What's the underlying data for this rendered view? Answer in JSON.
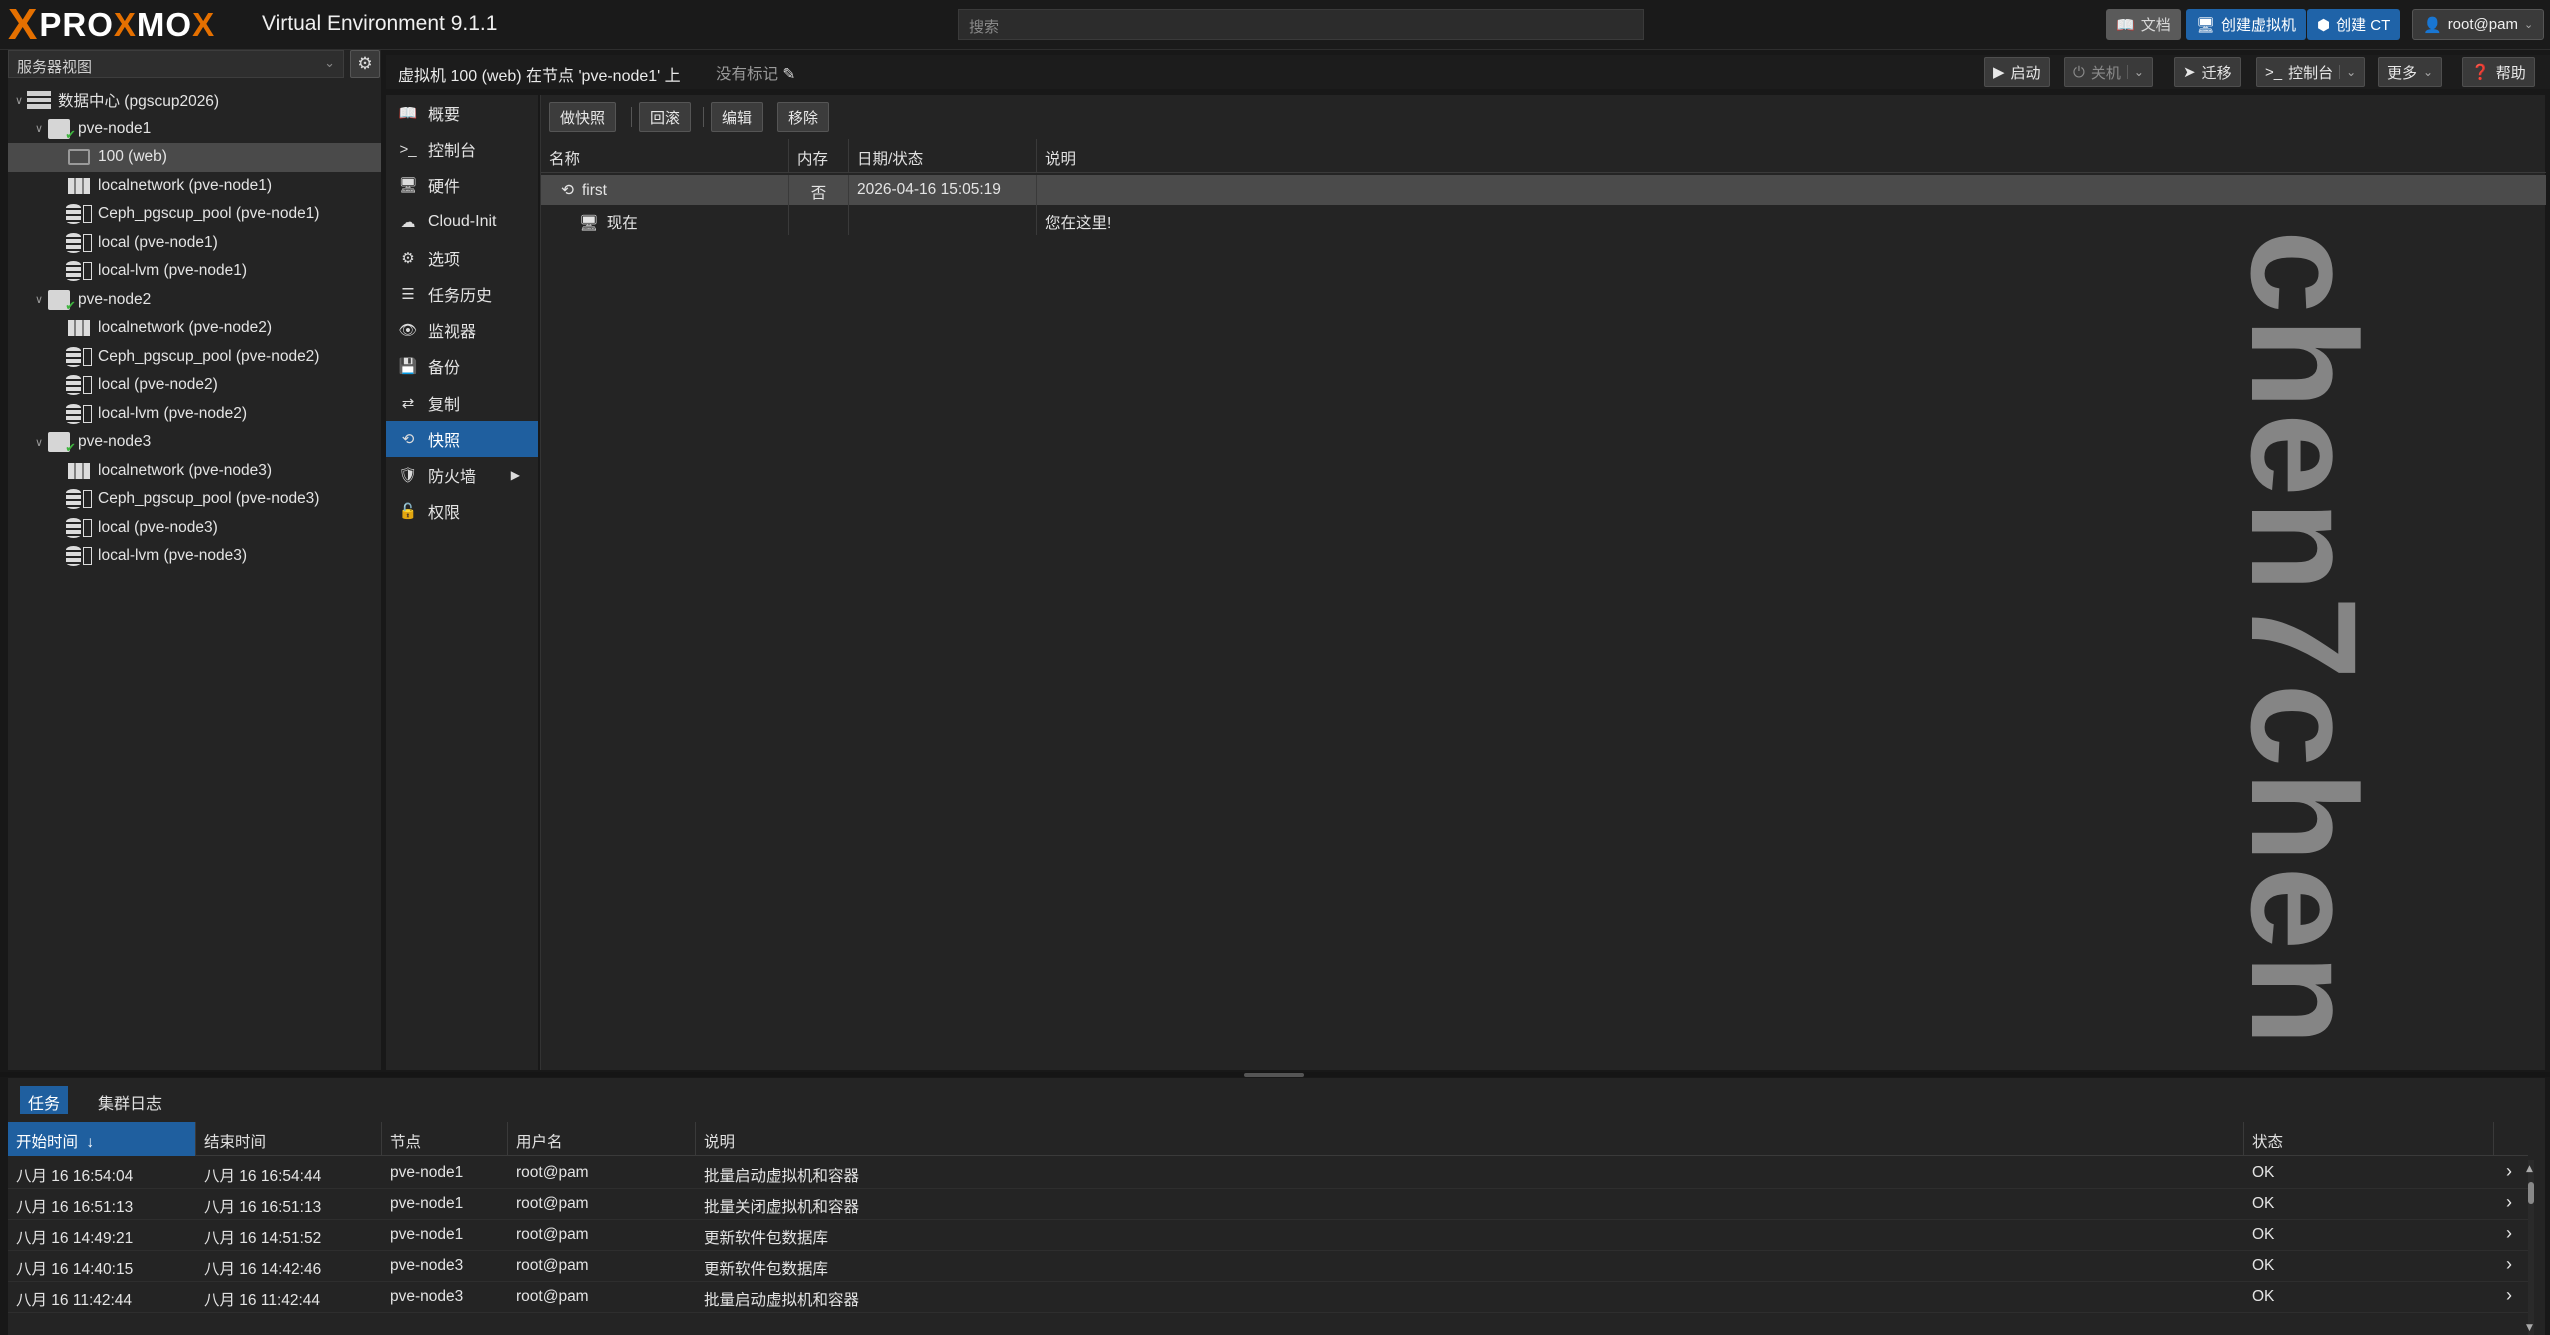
{
  "app": {
    "logo_x": "X",
    "logo_text_a": "PRO",
    "logo_text_b": "X",
    "logo_text_c": "MO",
    "logo_text_d": "X",
    "title": "Virtual Environment 9.1.1",
    "search_placeholder": "搜索"
  },
  "topbar": {
    "docs": "文档",
    "create_vm": "创建虚拟机",
    "create_ct": "创建 CT",
    "user": "root@pam"
  },
  "resource_tree": {
    "view": "服务器视图",
    "items": [
      {
        "label": "数据中心 (pgscup2026)",
        "type": "datacenter"
      },
      {
        "label": "pve-node1",
        "type": "node"
      },
      {
        "label": "100 (web)",
        "type": "vm"
      },
      {
        "label": "localnetwork (pve-node1)",
        "type": "network"
      },
      {
        "label": "Ceph_pgscup_pool (pve-node1)",
        "type": "storage"
      },
      {
        "label": "local (pve-node1)",
        "type": "storage"
      },
      {
        "label": "local-lvm (pve-node1)",
        "type": "storage"
      },
      {
        "label": "pve-node2",
        "type": "node"
      },
      {
        "label": "localnetwork (pve-node2)",
        "type": "network"
      },
      {
        "label": "Ceph_pgscup_pool (pve-node2)",
        "type": "storage"
      },
      {
        "label": "local (pve-node2)",
        "type": "storage"
      },
      {
        "label": "local-lvm (pve-node2)",
        "type": "storage"
      },
      {
        "label": "pve-node3",
        "type": "node"
      },
      {
        "label": "localnetwork (pve-node3)",
        "type": "network"
      },
      {
        "label": "Ceph_pgscup_pool (pve-node3)",
        "type": "storage"
      },
      {
        "label": "local (pve-node3)",
        "type": "storage"
      },
      {
        "label": "local-lvm (pve-node3)",
        "type": "storage"
      }
    ]
  },
  "content_header": {
    "title": "虚拟机 100 (web) 在节点 'pve-node1' 上",
    "tags": "没有标记",
    "start": "启动",
    "shutdown": "关机",
    "migrate": "迁移",
    "console": "控制台",
    "more": "更多",
    "help": "帮助"
  },
  "vm_nav": {
    "items": [
      {
        "label": "概要",
        "icon": "book-icon"
      },
      {
        "label": "控制台",
        "icon": "terminal-icon"
      },
      {
        "label": "硬件",
        "icon": "desktop-icon"
      },
      {
        "label": "Cloud-Init",
        "icon": "cloud-icon"
      },
      {
        "label": "选项",
        "icon": "gear-icon"
      },
      {
        "label": "任务历史",
        "icon": "list-icon"
      },
      {
        "label": "监视器",
        "icon": "eye-icon"
      },
      {
        "label": "备份",
        "icon": "floppy-icon"
      },
      {
        "label": "复制",
        "icon": "retweet-icon"
      },
      {
        "label": "快照",
        "icon": "history-icon"
      },
      {
        "label": "防火墙",
        "icon": "shield-icon"
      },
      {
        "label": "权限",
        "icon": "unlock-icon"
      }
    ]
  },
  "snapshots": {
    "toolbar": {
      "take": "做快照",
      "rollback": "回滚",
      "edit": "编辑",
      "remove": "移除"
    },
    "columns": {
      "name": "名称",
      "ram": "内存",
      "date": "日期/状态",
      "description": "说明"
    },
    "rows": [
      {
        "name": "first",
        "ram": "否",
        "date": "2026-04-16 15:05:19",
        "description": ""
      },
      {
        "name": "现在",
        "ram": "",
        "date": "",
        "description": "您在这里!"
      }
    ]
  },
  "watermark": "chen7chen",
  "bottom": {
    "tabs": {
      "tasks": "任务",
      "cluster_log": "集群日志"
    },
    "columns": {
      "start": "开始时间",
      "end": "结束时间",
      "node": "节点",
      "user": "用户名",
      "description": "说明",
      "status": "状态"
    },
    "rows": [
      {
        "start": "八月 16 16:54:04",
        "end": "八月 16 16:54:44",
        "node": "pve-node1",
        "user": "root@pam",
        "description": "批量启动虚拟机和容器",
        "status": "OK"
      },
      {
        "start": "八月 16 16:51:13",
        "end": "八月 16 16:51:13",
        "node": "pve-node1",
        "user": "root@pam",
        "description": "批量关闭虚拟机和容器",
        "status": "OK"
      },
      {
        "start": "八月 16 14:49:21",
        "end": "八月 16 14:51:52",
        "node": "pve-node1",
        "user": "root@pam",
        "description": "更新软件包数据库",
        "status": "OK"
      },
      {
        "start": "八月 16 14:40:15",
        "end": "八月 16 14:42:46",
        "node": "pve-node3",
        "user": "root@pam",
        "description": "更新软件包数据库",
        "status": "OK"
      },
      {
        "start": "八月 16 11:42:44",
        "end": "八月 16 11:42:44",
        "node": "pve-node3",
        "user": "root@pam",
        "description": "批量启动虚拟机和容器",
        "status": "OK"
      }
    ]
  }
}
